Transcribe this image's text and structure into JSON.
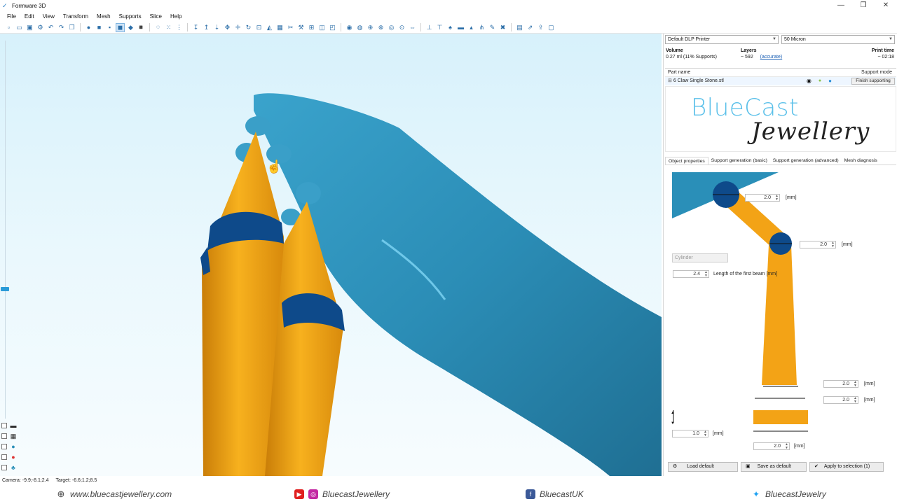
{
  "window": {
    "title": "Formware 3D",
    "controls": [
      "—",
      "❐",
      "✕"
    ]
  },
  "menu": [
    "File",
    "Edit",
    "View",
    "Transform",
    "Mesh",
    "Supports",
    "Slice",
    "Help"
  ],
  "toolbar_icons": [
    "new-icon",
    "open-icon",
    "save-icon",
    "settings-icon",
    "undo-icon",
    "redo-icon",
    "copy-icon",
    "sep",
    "sphere-icon",
    "cube-front-icon",
    "cube-side-icon",
    "cube-top-icon",
    "cube-iso-icon",
    "cube-bottom-icon",
    "sep",
    "move-points-icon",
    "scale-points-icon",
    "select-points-icon",
    "sep",
    "drop-icon",
    "lift-icon",
    "drop-all-icon",
    "move-icon",
    "translate-icon",
    "rotate-icon",
    "fit-icon",
    "mirror-icon",
    "grid-icon",
    "cut-icon",
    "repair-icon",
    "arrange-icon",
    "hollow-icon",
    "shell-icon",
    "sep",
    "view-point-icon",
    "view-sphere-icon",
    "view-axis-icon",
    "view-cube-icon",
    "view-ring-icon",
    "view-target-icon",
    "view-zoom-icon",
    "sep",
    "support-auto-icon",
    "support-beam-icon",
    "support-tree-icon",
    "support-base-icon",
    "support-tip-icon",
    "support-branch-icon",
    "support-edit-icon",
    "support-delete-icon",
    "sep",
    "slice-icon",
    "export-icon",
    "upload-icon",
    "frame-icon"
  ],
  "view_toggles": [
    "layer-icon",
    "grid-toggle-icon",
    "globe-icon",
    "red-dot-icon",
    "tree-icon"
  ],
  "status": {
    "camera": "Camera:  -9.9;-8.1;2.4",
    "target": "Target:  -6.6;1.2;8.5"
  },
  "panel": {
    "printer": "Default DLP Printer",
    "resolution": "50 Micron",
    "volume_label": "Volume",
    "volume_value": "0.27 ml (11% Supports)",
    "layers_label": "Layers",
    "layers_value": "~ 592",
    "layers_link": "(accurate)",
    "print_time_label": "Print time",
    "print_time_value": "~ 02:18",
    "parts": {
      "header_name": "Part name",
      "header_mode": "Support mode",
      "row_name": "6 Claw Single Stone.stl",
      "row_expand": "⊞",
      "finish_button": "Finish supporting"
    },
    "logo": {
      "line1": "BlueCast",
      "line2": "Jewellery"
    },
    "tabs": [
      "Object properties",
      "Support generation (basic)",
      "Support generation (advanced)",
      "Mesh diagnosis"
    ],
    "props": {
      "tip_top": "2.0",
      "tip_lower": "2.0",
      "unit": "[mm]",
      "shape_select": "Cylinder",
      "first_beam_value": "2.4",
      "first_beam_label": "Length of the first beam [mm]",
      "base_a": "2.0",
      "base_b": "2.0",
      "height_value": "1.0",
      "base_width": "2.0"
    },
    "buttons": {
      "load": "Load default",
      "save": "Save as default",
      "apply": "Apply to selection (1)"
    }
  },
  "footer": {
    "website": "www.bluecastjewellery.com",
    "social1": "BluecastJewellery",
    "social2": "BluecastUK",
    "social3": "BluecastJewelry"
  },
  "colors": {
    "model_blue": "#2a8fb8",
    "support_orange": "#f3a316",
    "tip_dark": "#0e4a8a",
    "accent": "#1a5fb4"
  }
}
